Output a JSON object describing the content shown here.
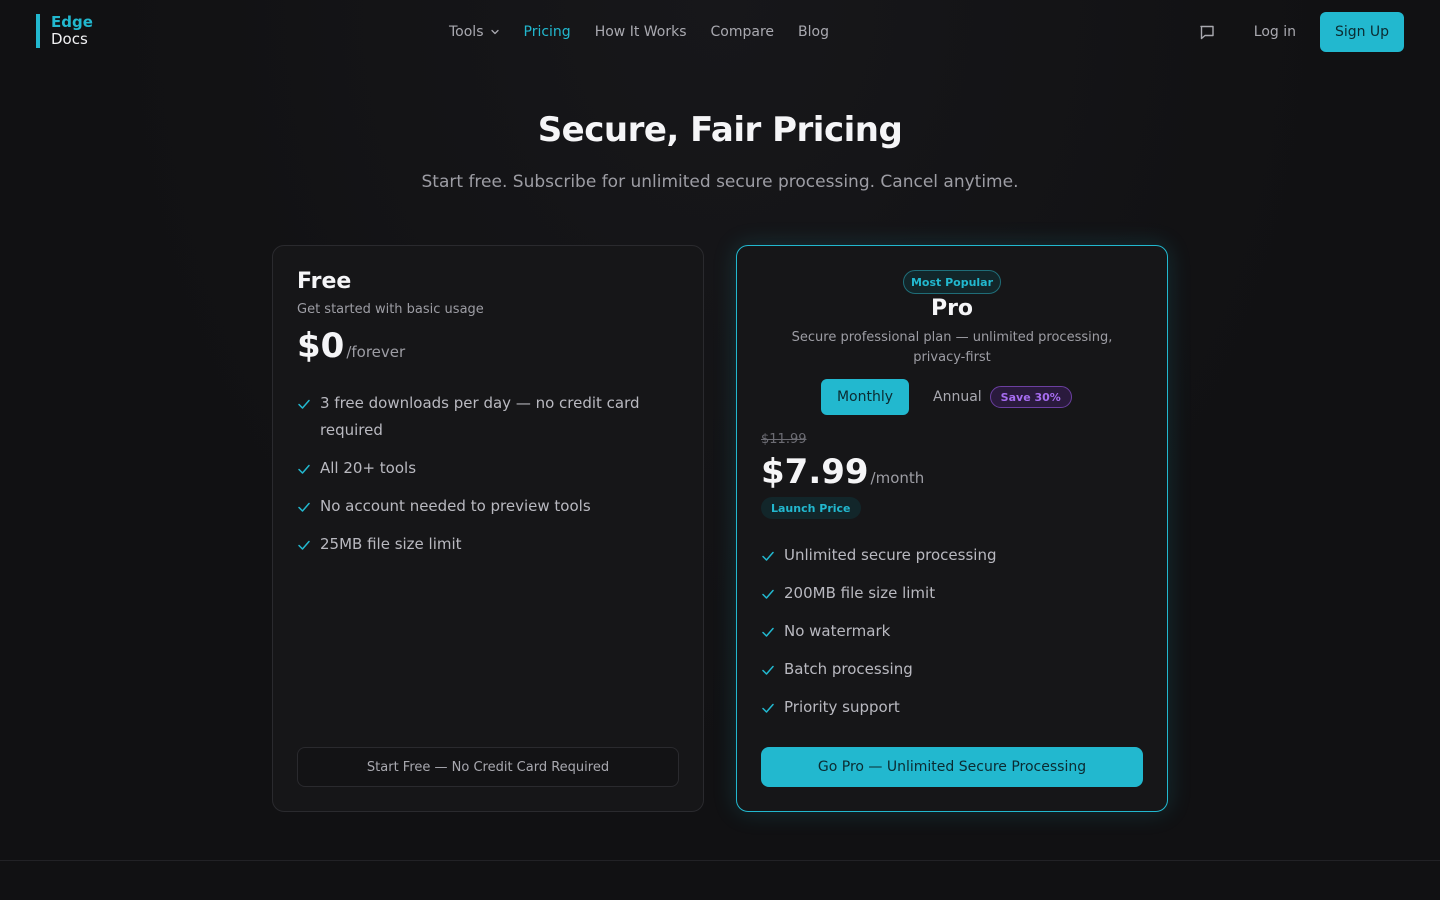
{
  "brand": {
    "line1": "Edge",
    "line2": "Docs"
  },
  "nav": {
    "items": [
      {
        "label": "Tools"
      },
      {
        "label": "Pricing"
      },
      {
        "label": "How It Works"
      },
      {
        "label": "Compare"
      },
      {
        "label": "Blog"
      }
    ],
    "active": "Pricing"
  },
  "header": {
    "login_label": "Log in",
    "signup_label": "Sign Up"
  },
  "hero": {
    "title": "Secure, Fair Pricing",
    "subtitle": "Start free. Subscribe for unlimited secure processing. Cancel anytime."
  },
  "plans": {
    "free": {
      "name": "Free",
      "description": "Get started with basic usage",
      "price": "$0",
      "period": "/forever",
      "features": [
        "3 free downloads per day — no credit card required",
        "All 20+ tools",
        "No account needed to preview tools",
        "25MB file size limit"
      ],
      "cta": "Start Free — No Credit Card Required"
    },
    "pro": {
      "badge": "Most Popular",
      "name": "Pro",
      "description": "Secure professional plan — unlimited processing, privacy-first",
      "billing": {
        "monthly": "Monthly",
        "annual": "Annual",
        "save": "Save 30%",
        "selected": "Monthly"
      },
      "old_price": "$11.99",
      "price": "$7.99",
      "period": "/month",
      "tag": "Launch Price",
      "features": [
        "Unlimited secure processing",
        "200MB file size limit",
        "No watermark",
        "Batch processing",
        "Priority support"
      ],
      "cta": "Go Pro — Unlimited Secure Processing"
    }
  },
  "colors": {
    "accent": "#22b8cf",
    "background": "#111113",
    "save_badge": "#a66cf0"
  }
}
